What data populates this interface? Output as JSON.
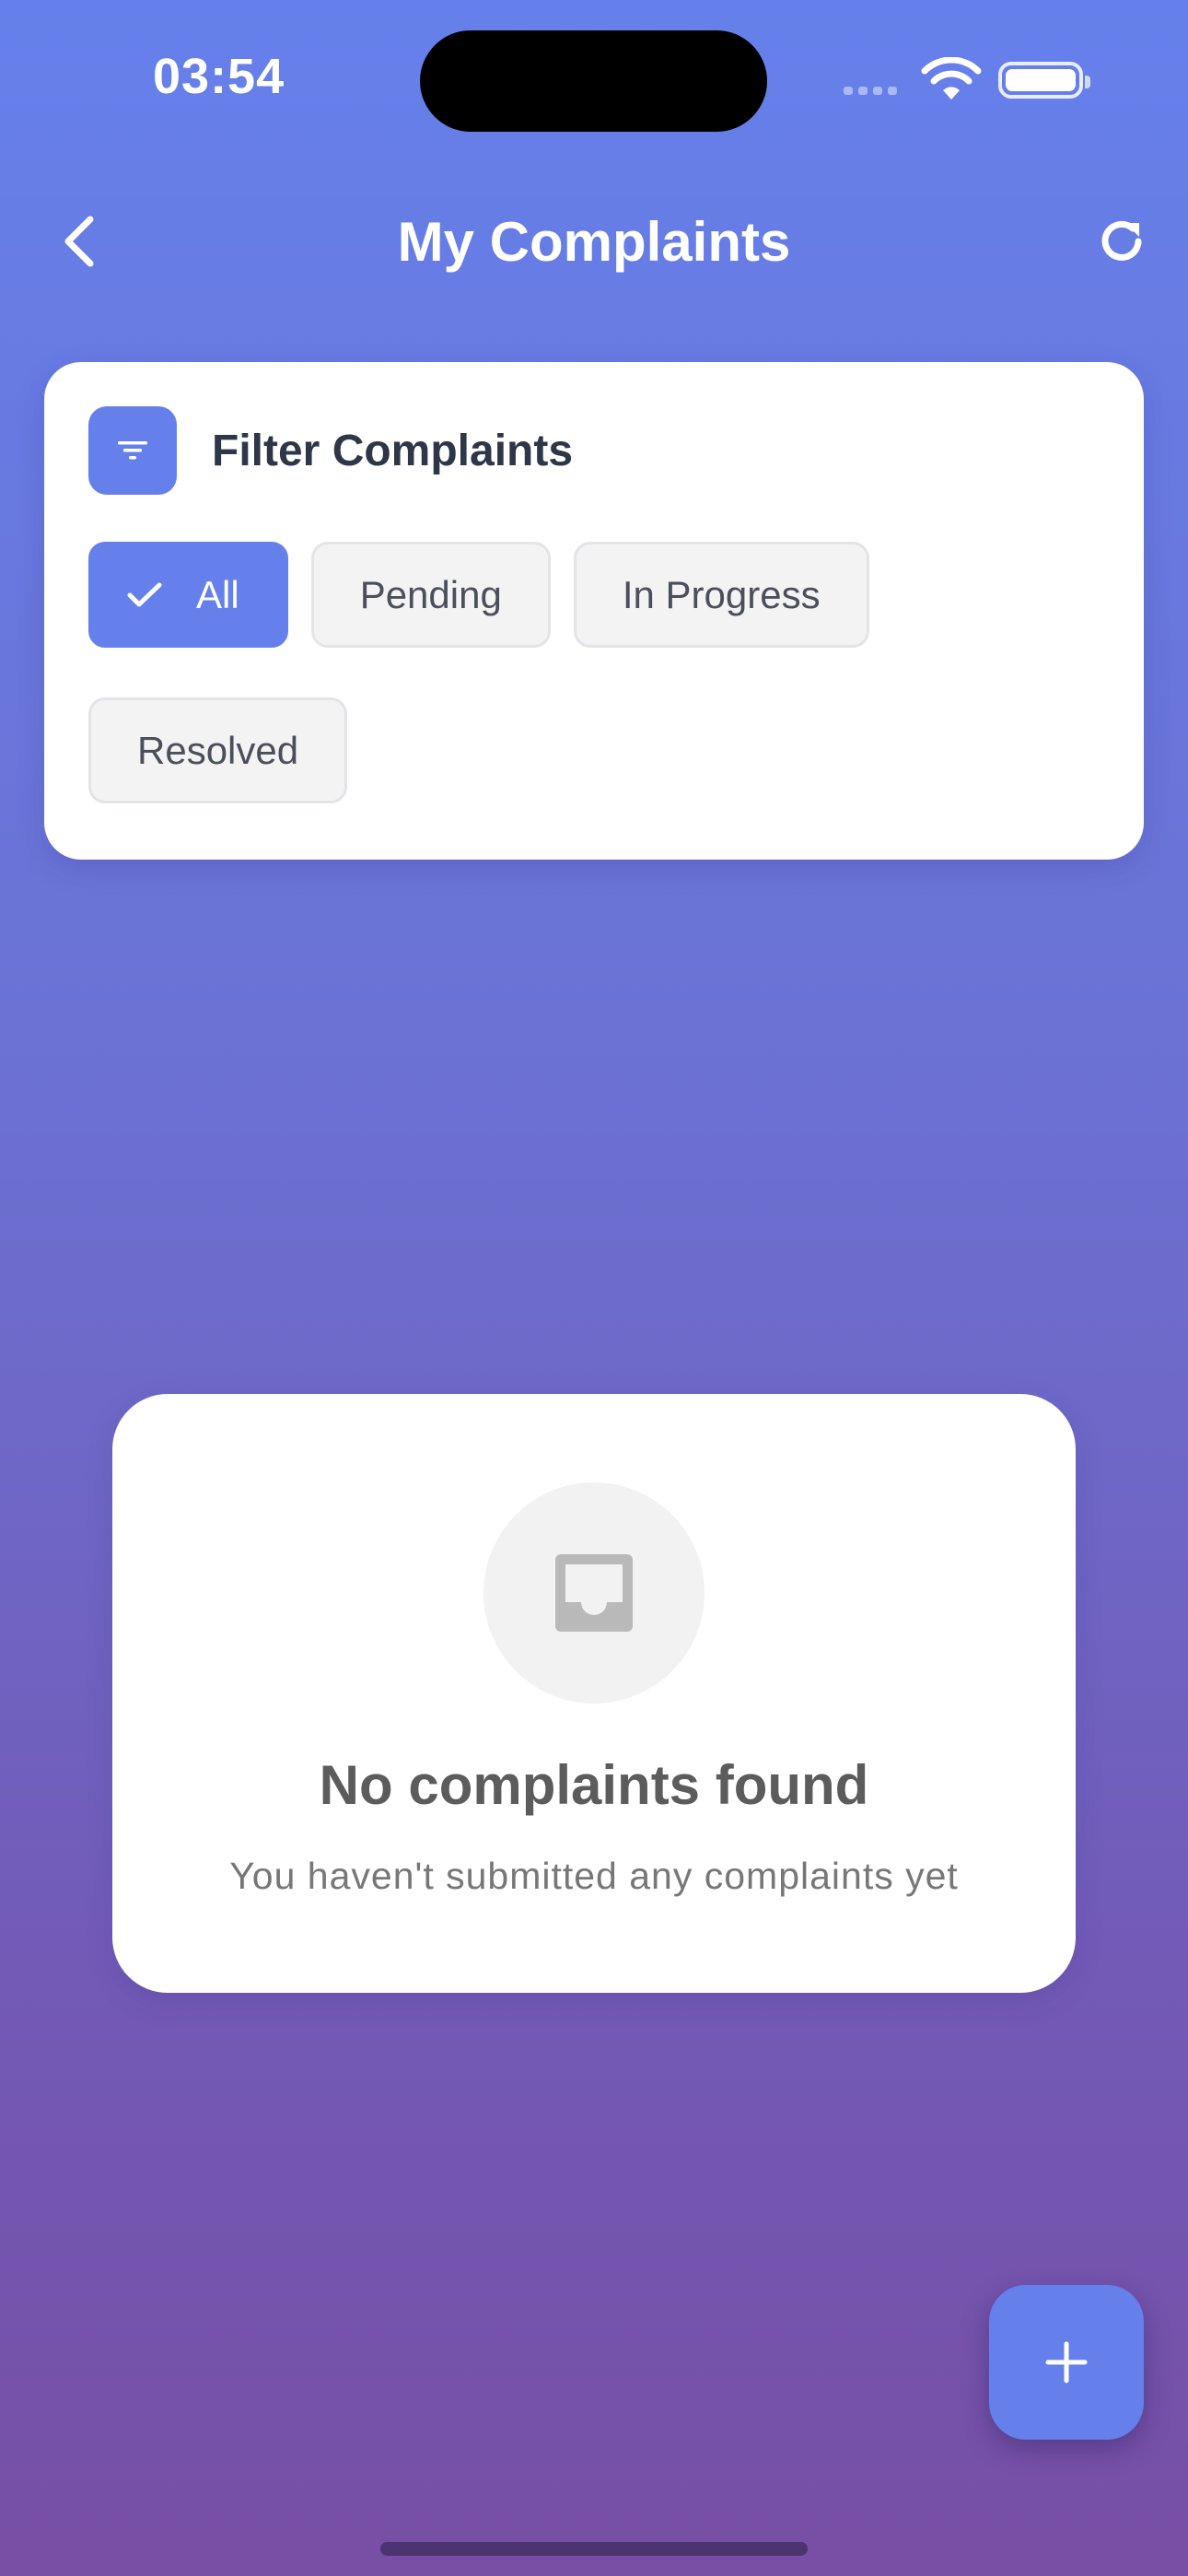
{
  "status_bar": {
    "time": "03:54",
    "icons": [
      "cellular-signal-icon",
      "wifi-icon",
      "battery-icon"
    ]
  },
  "header": {
    "title": "My Complaints",
    "back_icon": "chevron-left-icon",
    "refresh_icon": "refresh-icon"
  },
  "filter": {
    "title": "Filter Complaints",
    "icon": "filter-icon",
    "chips": [
      {
        "label": "All",
        "selected": true
      },
      {
        "label": "Pending",
        "selected": false
      },
      {
        "label": "In Progress",
        "selected": false
      },
      {
        "label": "Resolved",
        "selected": false
      }
    ]
  },
  "empty_state": {
    "icon": "inbox-icon",
    "title": "No complaints found",
    "subtitle": "You haven't submitted any complaints yet"
  },
  "fab": {
    "icon": "plus-icon"
  },
  "colors": {
    "accent": "#6680eb",
    "gradient_top": "#6680eb",
    "gradient_bottom": "#774fa4",
    "card": "#ffffff"
  }
}
